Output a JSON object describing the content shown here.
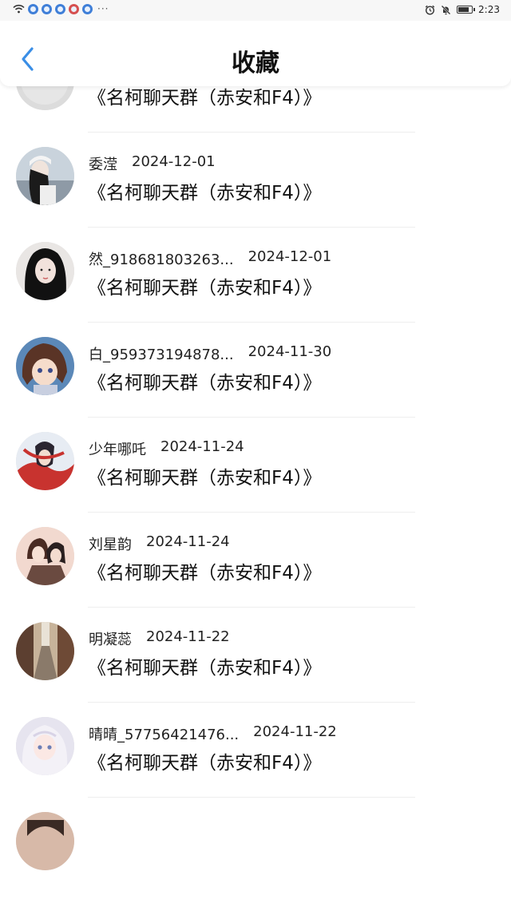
{
  "status_bar": {
    "time": "2:23",
    "more_indicator": "···",
    "battery_level": 0.7,
    "icons": [
      "wifi-icon",
      "app-notification-icon",
      "alarm-icon",
      "mute-icon",
      "battery-icon"
    ]
  },
  "header": {
    "title": "收藏",
    "back_icon": "chevron-left-icon",
    "accent_color": "#3a8ee6"
  },
  "favorites": [
    {
      "user": "",
      "date": "",
      "chat": "《名柯聊天群（赤安和F4）》"
    },
    {
      "user": "委滢",
      "date": "2024-12-01",
      "chat": "《名柯聊天群（赤安和F4）》"
    },
    {
      "user": "然_918681803263...",
      "date": "2024-12-01",
      "chat": "《名柯聊天群（赤安和F4）》"
    },
    {
      "user": "白_959373194878...",
      "date": "2024-11-30",
      "chat": "《名柯聊天群（赤安和F4）》"
    },
    {
      "user": "少年哪吒",
      "date": "2024-11-24",
      "chat": "《名柯聊天群（赤安和F4）》"
    },
    {
      "user": "刘星韵",
      "date": "2024-11-24",
      "chat": "《名柯聊天群（赤安和F4）》"
    },
    {
      "user": "明凝蕊",
      "date": "2024-11-22",
      "chat": "《名柯聊天群（赤安和F4）》"
    },
    {
      "user": "晴晴_57756421476...",
      "date": "2024-11-22",
      "chat": "《名柯聊天群（赤安和F4）》"
    },
    {
      "user": "",
      "date": "",
      "chat": ""
    }
  ]
}
